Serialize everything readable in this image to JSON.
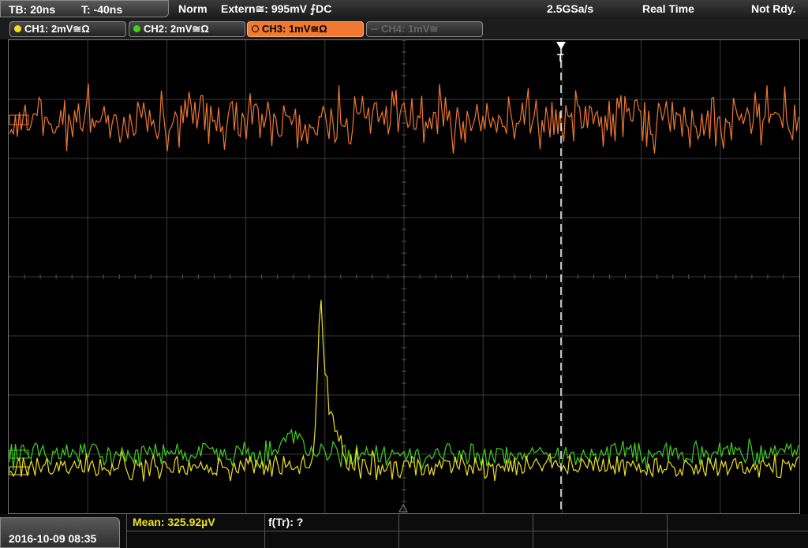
{
  "topbar": {
    "timebase": "TB: 20ns",
    "trigger_time": "T: -40ns",
    "mode": "Norm",
    "trigger_source": "Extern≅: 995mV ⨍DC",
    "sample_rate": "2.5GSa/s",
    "acq_mode": "Real Time",
    "status": "Not Rdy."
  },
  "channels": [
    {
      "label": "CH1: 2mV≅Ω",
      "color": "#f0e020",
      "active": true
    },
    {
      "label": "CH2: 2mV≅Ω",
      "color": "#40d020",
      "active": true
    },
    {
      "label": "CH3: 1mV≅Ω",
      "color": "#f08030",
      "active": true,
      "selected": true
    },
    {
      "label": "CH4: 1mV≅",
      "color": "#555555",
      "active": false
    }
  ],
  "trigger_marker": "T",
  "measurements": {
    "mean": "Mean: 325.92µV",
    "freq": "f(Tr): ?"
  },
  "datetime": "2016-10-09 08:35",
  "colors": {
    "ch1": "#f0e020",
    "ch2": "#40d020",
    "ch3": "#f07830",
    "grid": "#444444",
    "trigger_line": "#ffffff"
  }
}
